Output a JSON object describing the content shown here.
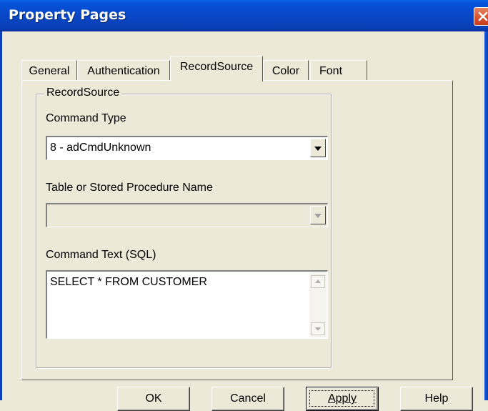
{
  "window": {
    "title": "Property Pages"
  },
  "tabs": [
    {
      "label": "General"
    },
    {
      "label": "Authentication"
    },
    {
      "label": "RecordSource"
    },
    {
      "label": "Color"
    },
    {
      "label": "Font"
    }
  ],
  "active_tab": "RecordSource",
  "groupbox": {
    "label": "RecordSource"
  },
  "command_type": {
    "label": "Command Type",
    "value": "8 - adCmdUnknown"
  },
  "table_name": {
    "label": "Table or Stored Procedure Name",
    "value": ""
  },
  "command_text": {
    "label": "Command Text (SQL)",
    "value": "SELECT * FROM CUSTOMER"
  },
  "buttons": {
    "ok": "OK",
    "cancel": "Cancel",
    "apply": "Apply",
    "help": "Help"
  },
  "colors": {
    "titlebar": "#0a3fb6",
    "dialog_bg": "#ece9d8",
    "close": "#d6502c"
  }
}
